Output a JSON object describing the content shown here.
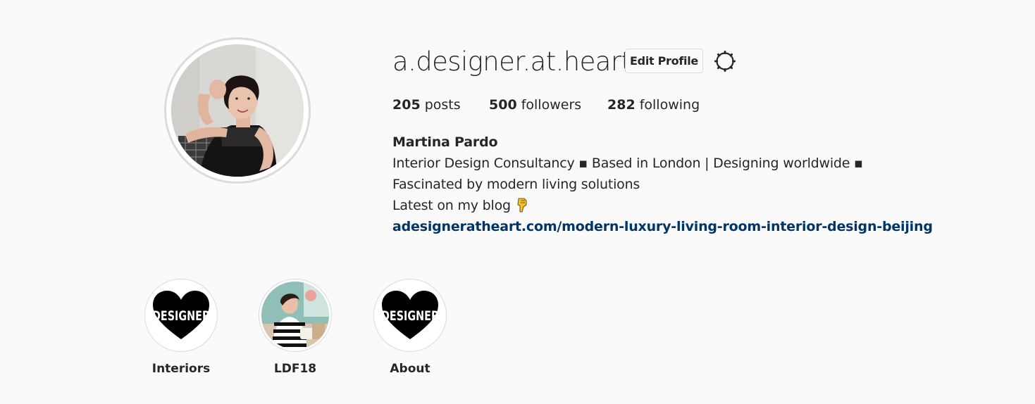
{
  "profile": {
    "username": "a.designer.at.heart",
    "edit_label": "Edit Profile",
    "settings_icon": "gear-icon",
    "avatar_icon": "profile-photo"
  },
  "stats": {
    "posts_count": "205",
    "posts_label": "posts",
    "followers_count": "500",
    "followers_label": "followers",
    "following_count": "282",
    "following_label": "following"
  },
  "bio": {
    "full_name": "Martina Pardo",
    "line1": "Interior Design Consultancy ▪ Based in London | Designing worldwide ▪ Fascinated by modern living solutions",
    "line2": "Latest on my blog",
    "emoji_icon": "pointing-down-icon",
    "link": "adesigneratheart.com/modern-luxury-living-room-interior-design-beijing"
  },
  "highlights": [
    {
      "label": "Interiors",
      "cover_text": "DESIGNER"
    },
    {
      "label": "LDF18"
    },
    {
      "label": "About",
      "cover_text": "DESIGNER"
    }
  ],
  "colors": {
    "background": "#fafafa",
    "text": "#262626",
    "link": "#003569",
    "border": "#dbdbdb"
  }
}
